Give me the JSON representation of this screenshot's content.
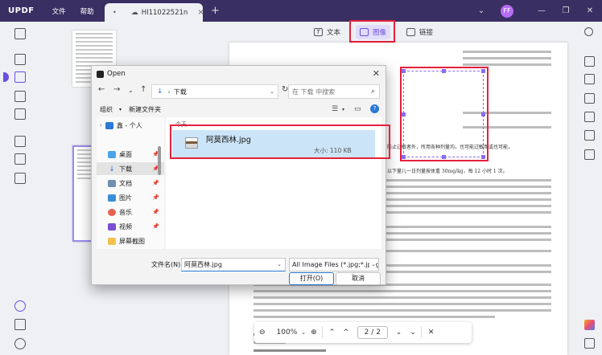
{
  "app": {
    "logo": "UPDF",
    "menu": [
      "文件",
      "帮助"
    ],
    "tab_title": "HI11022521n",
    "avatar_letter": "FF",
    "accent": "#6b4ee0"
  },
  "edit_tools": {
    "text_label": "文本",
    "image_label": "图像",
    "link_label": "链接"
  },
  "zoom_bar": {
    "zoom": "100%",
    "page_current": "2",
    "page_total": "2"
  },
  "document_text": {
    "line1": "防止过敏者外，所用各种剂量均，也可能过敏而或也可能，",
    "line2": "以下量儿一日剂量按体重 30mg/kg，每 12 小时 1 次。"
  },
  "dialog": {
    "title": "Open",
    "address": "下载",
    "search_placeholder": "在 下载 中搜索",
    "organize_label": "组织",
    "new_folder_label": "新建文件夹",
    "help_label": "?",
    "sidebar": [
      {
        "label": "鑫 - 个人",
        "icon": "cloud-icon"
      },
      {
        "label": "桌面",
        "icon": "desktop-icon"
      },
      {
        "label": "下载",
        "icon": "download-icon"
      },
      {
        "label": "文档",
        "icon": "document-icon"
      },
      {
        "label": "图片",
        "icon": "picture-icon"
      },
      {
        "label": "音乐",
        "icon": "music-icon"
      },
      {
        "label": "视频",
        "icon": "video-icon"
      },
      {
        "label": "屏幕截图",
        "icon": "folder-icon"
      }
    ],
    "group_header": "今天",
    "file": {
      "name": "阿莫西林.jpg",
      "size": "大小: 110 KB"
    },
    "filename_label": "文件名(N):",
    "filename_value": "阿莫西林.jpg",
    "filetype_value": "All Image Files (*.jpg;*.jpeg;*.",
    "open_button": "打开(O)",
    "cancel_button": "取消"
  }
}
